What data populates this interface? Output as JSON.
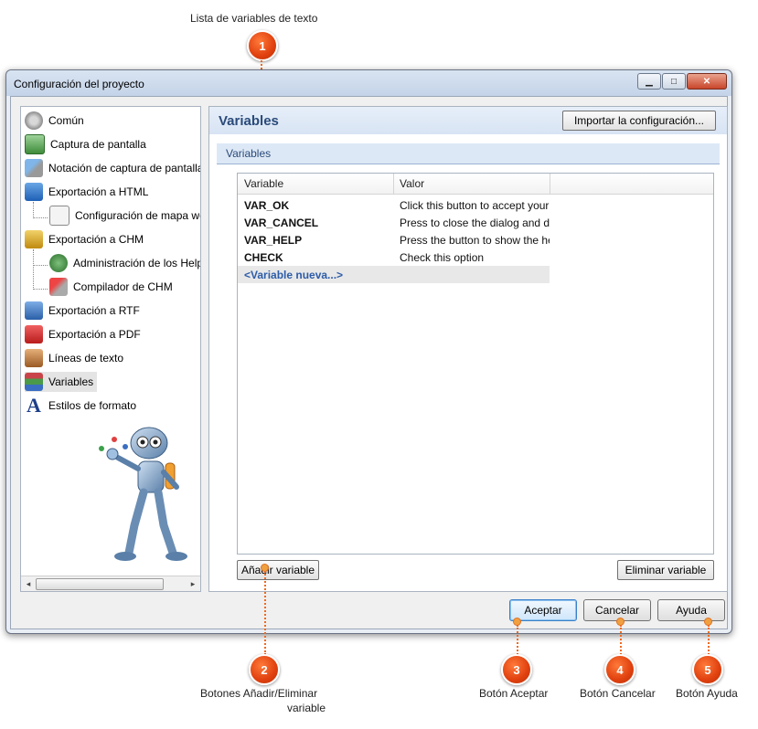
{
  "callouts": {
    "c1": {
      "number": "1",
      "text": "Lista de variables de texto"
    },
    "c2": {
      "number": "2",
      "text_line1": "Botones Añadir/Eliminar",
      "text_line2": "variable"
    },
    "c3": {
      "number": "3",
      "text": "Botón Aceptar"
    },
    "c4": {
      "number": "4",
      "text": "Botón Cancelar"
    },
    "c5": {
      "number": "5",
      "text": "Botón Ayuda"
    }
  },
  "window": {
    "title": "Configuración del proyecto"
  },
  "tree": {
    "items": [
      {
        "label": "Común",
        "icon": "gear-icon"
      },
      {
        "label": "Captura de pantalla",
        "icon": "screen-capture-icon"
      },
      {
        "label": "Notación de captura de pantalla",
        "icon": "annotation-icon"
      },
      {
        "label": "Exportación a HTML",
        "icon": "html-icon"
      },
      {
        "label": "Configuración de mapa web",
        "icon": "sitemap-icon"
      },
      {
        "label": "Exportación a CHM",
        "icon": "chm-icon"
      },
      {
        "label": "Administración de los Help ID",
        "icon": "help-id-icon"
      },
      {
        "label": "Compilador de CHM",
        "icon": "compiler-icon"
      },
      {
        "label": "Exportación a RTF",
        "icon": "rtf-icon"
      },
      {
        "label": "Exportación a PDF",
        "icon": "pdf-icon"
      },
      {
        "label": "Líneas de texto",
        "icon": "text-lines-icon"
      },
      {
        "label": "Variables",
        "icon": "variables-icon"
      },
      {
        "label": "Estilos de formato",
        "icon": "format-styles-icon"
      }
    ]
  },
  "panel": {
    "title": "Variables",
    "import_button": "Importar la configuración...",
    "group_title": "Variables",
    "columns": [
      "Variable",
      "Valor"
    ],
    "rows": [
      {
        "name": "VAR_OK",
        "value": "Click this button to accept your changes"
      },
      {
        "name": "VAR_CANCEL",
        "value": "Press to close the dialog and discard changes"
      },
      {
        "name": "VAR_HELP",
        "value": "Press the button to show the help"
      },
      {
        "name": "CHECK",
        "value": "Check this option"
      }
    ],
    "new_row": "<Variable nueva...>",
    "add_button": "Añadir variable",
    "delete_button": "Eliminar variable"
  },
  "dialog_buttons": {
    "ok": "Aceptar",
    "cancel": "Cancelar",
    "help": "Ayuda"
  },
  "colors": {
    "accent": "#2a4a7a",
    "badge": "#e0400e"
  }
}
